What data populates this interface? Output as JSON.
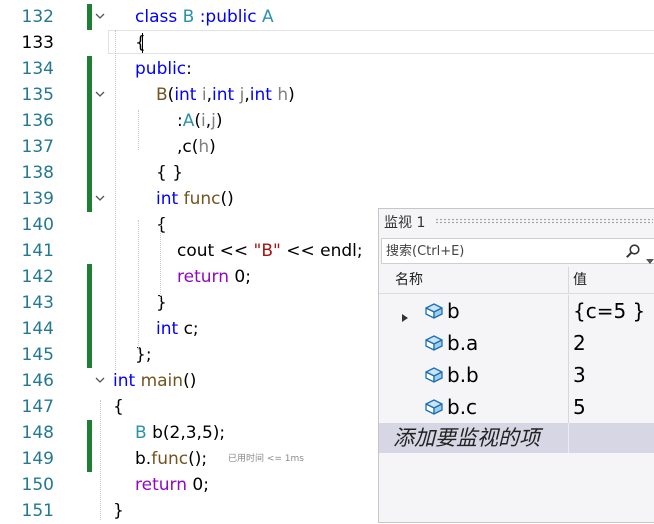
{
  "editor": {
    "lines": [
      {
        "n": "132",
        "tokens": [
          [
            "kw",
            "class"
          ],
          [
            "t",
            " "
          ],
          [
            "ty",
            "B"
          ],
          [
            "t",
            " "
          ],
          [
            "kw",
            ":public"
          ],
          [
            "t",
            " "
          ],
          [
            "ty",
            "A"
          ]
        ]
      },
      {
        "n": "133",
        "tokens": [
          [
            "t",
            "{"
          ]
        ]
      },
      {
        "n": "134",
        "tokens": [
          [
            "kw",
            "public"
          ],
          [
            "t",
            ":"
          ]
        ]
      },
      {
        "n": "135",
        "tokens": [
          [
            "fn",
            "B"
          ],
          [
            "t",
            "("
          ],
          [
            "kw",
            "int"
          ],
          [
            "t",
            " "
          ],
          [
            "pm",
            "i"
          ],
          [
            "t",
            ","
          ],
          [
            "kw",
            "int"
          ],
          [
            "t",
            " "
          ],
          [
            "pm",
            "j"
          ],
          [
            "t",
            ","
          ],
          [
            "kw",
            "int"
          ],
          [
            "t",
            " "
          ],
          [
            "pm",
            "h"
          ],
          [
            "t",
            ")"
          ]
        ]
      },
      {
        "n": "136",
        "tokens": [
          [
            "t",
            ":"
          ],
          [
            "ty",
            "A"
          ],
          [
            "t",
            "("
          ],
          [
            "pm",
            "i"
          ],
          [
            "t",
            ","
          ],
          [
            "pm",
            "j"
          ],
          [
            "t",
            ")"
          ]
        ]
      },
      {
        "n": "137",
        "tokens": [
          [
            "t",
            ",c("
          ],
          [
            "pm",
            "h"
          ],
          [
            "t",
            ")"
          ]
        ]
      },
      {
        "n": "138",
        "tokens": [
          [
            "t",
            "{ }"
          ]
        ]
      },
      {
        "n": "139",
        "tokens": [
          [
            "kw",
            "int"
          ],
          [
            "t",
            " "
          ],
          [
            "fn",
            "func"
          ],
          [
            "t",
            "()"
          ]
        ]
      },
      {
        "n": "140",
        "tokens": [
          [
            "t",
            "{"
          ]
        ]
      },
      {
        "n": "141",
        "tokens": [
          [
            "t",
            "cout "
          ],
          [
            "t",
            "<<"
          ],
          [
            "t",
            " "
          ],
          [
            "str",
            "\"B\""
          ],
          [
            "t",
            " << endl;"
          ]
        ]
      },
      {
        "n": "142",
        "tokens": [
          [
            "rt",
            "return"
          ],
          [
            "t",
            " 0;"
          ]
        ]
      },
      {
        "n": "143",
        "tokens": [
          [
            "t",
            "}"
          ]
        ]
      },
      {
        "n": "144",
        "tokens": [
          [
            "kw",
            "int"
          ],
          [
            "t",
            " c;"
          ]
        ]
      },
      {
        "n": "145",
        "tokens": [
          [
            "t",
            "};"
          ]
        ]
      },
      {
        "n": "146",
        "tokens": [
          [
            "kw",
            "int"
          ],
          [
            "t",
            " "
          ],
          [
            "fn",
            "main"
          ],
          [
            "t",
            "()"
          ]
        ]
      },
      {
        "n": "147",
        "tokens": [
          [
            "t",
            "{"
          ]
        ]
      },
      {
        "n": "148",
        "tokens": [
          [
            "ty",
            "B"
          ],
          [
            "t",
            " b(2,3,5);"
          ]
        ]
      },
      {
        "n": "149",
        "tokens": [
          [
            "t",
            "b."
          ],
          [
            "fn",
            "func"
          ],
          [
            "t",
            "();"
          ]
        ]
      },
      {
        "n": "150",
        "tokens": [
          [
            "rt",
            "return"
          ],
          [
            "t",
            " 0;"
          ]
        ]
      },
      {
        "n": "151",
        "tokens": [
          [
            "t",
            "}"
          ]
        ]
      }
    ],
    "elapsed_hint": "已用时间 <= 1ms"
  },
  "watch": {
    "title": "监视 1",
    "search_placeholder": "搜索(Ctrl+E)",
    "col_name": "名称",
    "col_value": "值",
    "rows": [
      {
        "name": "b",
        "value": "{c=5 }",
        "expandable": true
      },
      {
        "name": "b.a",
        "value": "2",
        "expandable": false
      },
      {
        "name": "b.b",
        "value": "3",
        "expandable": false
      },
      {
        "name": "b.c",
        "value": "5",
        "expandable": false
      }
    ],
    "add_item": "添加要监视的项"
  },
  "colors": {
    "keyword": "#0000ff",
    "type": "#2b91af",
    "function": "#74531f",
    "parameter": "#808080",
    "string": "#a31515",
    "control": "#8f08c4",
    "line_number": "#237893",
    "change_bar": "#1e7e34"
  }
}
